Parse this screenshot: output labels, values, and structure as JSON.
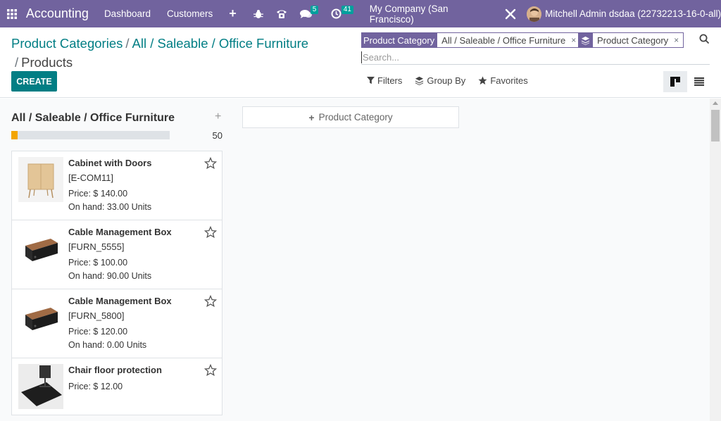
{
  "navbar": {
    "app_name": "Accounting",
    "menus": [
      "Dashboard",
      "Customers"
    ],
    "plus": "+",
    "chat_badge": "5",
    "activity_badge": "41",
    "company": "My Company (San Francisco)",
    "user": "Mitchell Admin dsdaa (22732213-16-0-all)"
  },
  "breadcrumb": {
    "items": [
      "Product Categories",
      "All / Saleable / Office Furniture"
    ],
    "separator": "/",
    "current": "Products"
  },
  "create_label": "CREATE",
  "search": {
    "facets": [
      {
        "label": "Product Category",
        "value": "All / Saleable / Office Furniture"
      },
      {
        "label": "",
        "icon": "layers-icon",
        "value": "Product Category"
      }
    ],
    "remove": "×",
    "placeholder": "Search..."
  },
  "filters": {
    "filters": "Filters",
    "group_by": "Group By",
    "favorites": "Favorites"
  },
  "kanban": {
    "column": {
      "title": "All / Saleable / Office Furniture",
      "add": "+",
      "count": "50",
      "progress_fraction": 0.04
    },
    "cards": [
      {
        "name": "Cabinet with Doors",
        "ref": "[E-COM11]",
        "price": "Price: $ 140.00",
        "stock": "On hand: 33.00 Units",
        "image": "cabinet"
      },
      {
        "name": "Cable Management Box",
        "ref": "[FURN_5555]",
        "price": "Price: $ 100.00",
        "stock": "On hand: 90.00 Units",
        "image": "box"
      },
      {
        "name": "Cable Management Box",
        "ref": "[FURN_5800]",
        "price": "Price: $ 120.00",
        "stock": "On hand: 0.00 Units",
        "image": "box"
      },
      {
        "name": "Chair floor protection",
        "ref": "",
        "price": "Price: $ 12.00",
        "stock": "",
        "image": "mat"
      }
    ],
    "add_column": "Product Category"
  },
  "colors": {
    "brand": "#71639e",
    "primary": "#017e84",
    "progress": "#f3a500"
  }
}
